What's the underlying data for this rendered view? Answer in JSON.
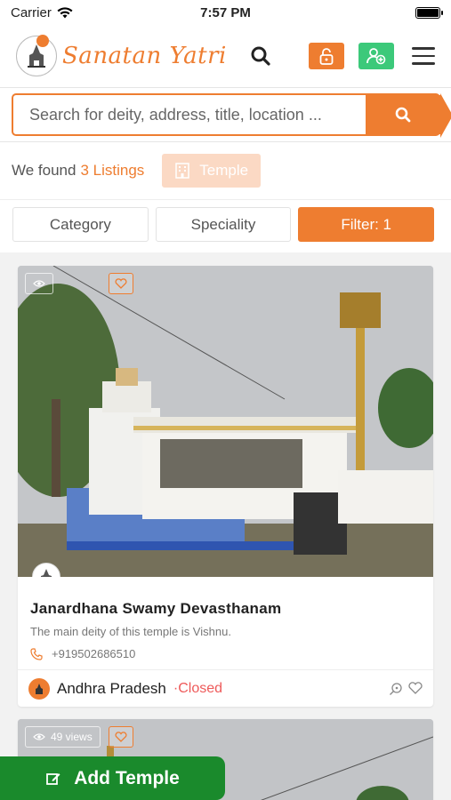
{
  "status_bar": {
    "carrier": "Carrier",
    "time": "7:57 PM"
  },
  "header": {
    "app_name": "Sanatan Yatri"
  },
  "search": {
    "placeholder": "Search for deity, address, title, location ..."
  },
  "results": {
    "prefix": "We found",
    "count_text": "3 Listings",
    "chip_label": "Temple"
  },
  "filters": {
    "category": "Category",
    "speciality": "Speciality",
    "filter": "Filter: 1"
  },
  "listings": [
    {
      "title": "Janardhana Swamy Devasthanam",
      "description": "The main deity of this temple is Vishnu.",
      "phone": "+919502686510",
      "state": "Andhra Pradesh",
      "status": "Closed"
    },
    {
      "views": "49 views"
    }
  ],
  "add_button": {
    "label": "Add Temple"
  },
  "colors": {
    "accent": "#ee7d30",
    "green": "#3cc97a",
    "add_green": "#1a8a2c",
    "closed_red": "#ee5a5a"
  }
}
